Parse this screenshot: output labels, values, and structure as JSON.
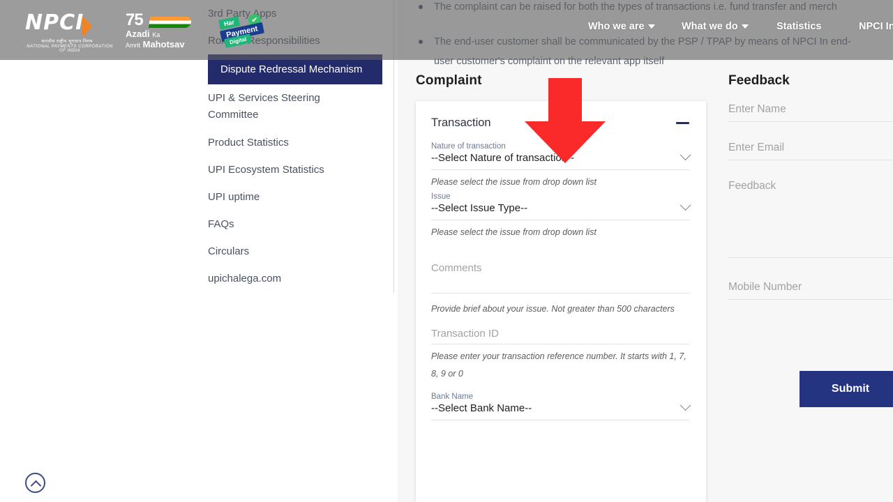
{
  "brand": {
    "logo_text": "NPCI",
    "logo_hindi": "भारतीय राष्ट्रीय भुगतान निगम",
    "logo_subtitle": "NATIONAL PAYMENTS CORPORATION OF INDIA",
    "azadi_number": "75",
    "azadi_line1": "Azadi",
    "azadi_ka": "Ka",
    "azadi_line2": "Amrit",
    "azadi_mahotsav": "Mahotsav",
    "har_badge": "Har",
    "payment_badge": "Payment",
    "digital_badge": "Digital",
    "check_glyph": "✔"
  },
  "top_nav": {
    "items": [
      {
        "label": "Who we are",
        "has_caret": true
      },
      {
        "label": "What we do",
        "has_caret": true
      },
      {
        "label": "Statistics",
        "has_caret": false
      },
      {
        "label": "NPCI In",
        "has_caret": false
      }
    ]
  },
  "info": {
    "bullet1": "The complaint can be raised for both the types of transactions i.e. fund transfer and merch",
    "bullet2": "The end-user customer shall be communicated by the PSP / TPAP by means of NPCI In end-user customer's complaint on the relevant app itself"
  },
  "sidebar": {
    "items": [
      {
        "label": "3rd Party Apps",
        "active": false
      },
      {
        "label": "Roles & Responsibilities",
        "active": false
      },
      {
        "label": "Dispute Redressal Mechanism",
        "active": true
      },
      {
        "label": "UPI & Services Steering Committee",
        "active": false
      },
      {
        "label": "Product Statistics",
        "active": false
      },
      {
        "label": "UPI Ecosystem Statistics",
        "active": false
      },
      {
        "label": "UPI uptime",
        "active": false
      },
      {
        "label": "FAQs",
        "active": false
      },
      {
        "label": "Circulars",
        "active": false
      },
      {
        "label": "upichalega.com",
        "active": false
      }
    ]
  },
  "complaint": {
    "section_title": "Complaint",
    "accordion_title": "Transaction",
    "nature": {
      "label": "Nature of transaction",
      "value": "--Select Nature of transaction--",
      "helper": "Please select the issue from drop down list"
    },
    "issue": {
      "label": "Issue",
      "value": "--Select Issue Type--",
      "helper": "Please select the issue from drop down list"
    },
    "comments": {
      "placeholder": "Comments",
      "value": "",
      "helper": "Provide brief about your issue. Not greater than 500 characters"
    },
    "transaction_id": {
      "placeholder": "Transaction ID",
      "value": "",
      "helper": "Please enter your transaction reference number. It starts with 1, 7, 8, 9 or 0"
    },
    "bank_name": {
      "label": "Bank Name",
      "value": "--Select Bank Name--"
    }
  },
  "feedback": {
    "section_title": "Feedback",
    "name_placeholder": "Enter Name",
    "name_value": "",
    "email_placeholder": "Enter Email",
    "email_value": "",
    "feedback_placeholder": "Feedback",
    "feedback_value": "",
    "mobile_placeholder": "Mobile Number",
    "mobile_value": "",
    "submit_label": "Submit"
  },
  "colors": {
    "brand_navy": "#253480",
    "active_nav_navy": "#242b6b",
    "arrow_red": "#FA2A2A",
    "orange_accent": "#F58220",
    "page_bg_gray": "#f7f7f7",
    "overlay_gray": "rgba(96,96,96,0.62)"
  }
}
